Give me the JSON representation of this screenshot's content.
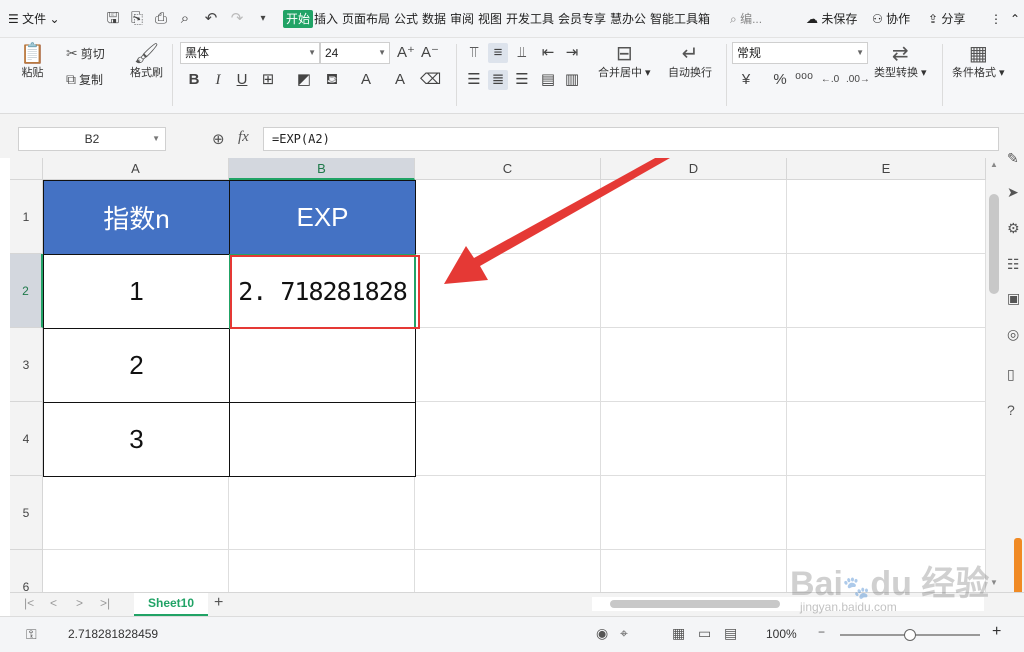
{
  "menu": {
    "file": "文件",
    "tabs": [
      "开始",
      "插入",
      "页面布局",
      "公式",
      "数据",
      "审阅",
      "视图",
      "开发工具",
      "会员专享",
      "慧办公",
      "智能工具箱"
    ],
    "search_placeholder": "编...",
    "unsaved": "未保存",
    "collab": "协作",
    "share": "分享"
  },
  "ribbon": {
    "paste": "粘贴",
    "cut": "剪切",
    "copy": "复制",
    "format_painter": "格式刷",
    "font_name": "黑体",
    "font_size": "24",
    "merge_center": "合并居中",
    "wrap_text": "自动换行",
    "number_format": "常规",
    "type_convert": "类型转换",
    "cond_format": "条件格式",
    "currency_symbol": "¥",
    "percent_symbol": "%"
  },
  "formula_bar": {
    "name_box": "B2",
    "fx_label": "fx",
    "formula": "=EXP(A2)"
  },
  "grid": {
    "columns": [
      "A",
      "B",
      "C",
      "D",
      "E"
    ],
    "rows": [
      "1",
      "2",
      "3",
      "4",
      "5",
      "6"
    ],
    "cells": {
      "A1": "指数n",
      "B1": "EXP",
      "A2": "1",
      "B2": "2. 718281828",
      "A3": "2",
      "A4": "3"
    }
  },
  "sheet_tab": "Sheet10",
  "status": {
    "value": "2.718281828459",
    "zoom": "100%"
  },
  "colors": {
    "accent": "#21a366",
    "header_fill": "#4472c4",
    "highlight_red": "#e53935"
  },
  "watermark": "Baidu 经验 jingyan.baidu.com"
}
